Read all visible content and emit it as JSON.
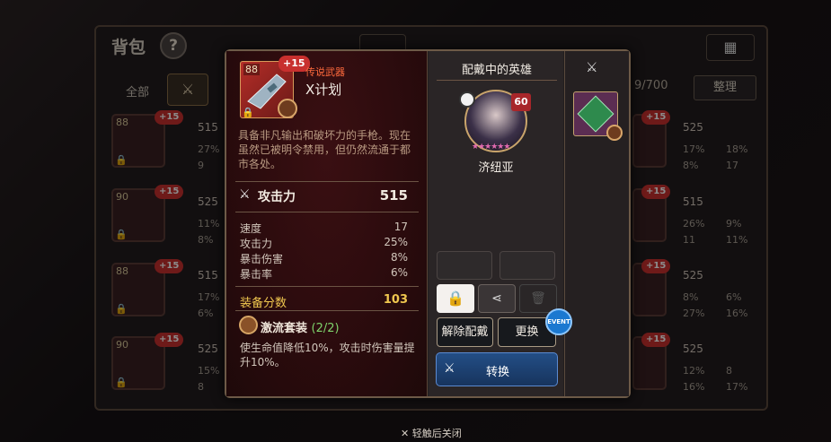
{
  "background": {
    "bag_title": "背包",
    "help_label": "?",
    "filter_all": "全部",
    "capacity": "9/700",
    "sort_label": "整理",
    "close_hint": "轻触后关闭",
    "left_items": [
      {
        "level": "88",
        "plus": "+15",
        "main": "515",
        "sub1": "27%",
        "sub2": "9"
      },
      {
        "level": "90",
        "plus": "+15",
        "main": "525",
        "sub1": "11%",
        "sub2": "8%"
      },
      {
        "level": "88",
        "plus": "+15",
        "main": "515",
        "sub1": "17%",
        "sub2": "6%"
      },
      {
        "level": "90",
        "plus": "+15",
        "main": "525",
        "sub1": "15%",
        "sub2": "8"
      }
    ],
    "right_items": [
      {
        "plus": "+15",
        "main": "525",
        "sub1": "17%",
        "sub2": "18%",
        "sub3": "8%",
        "sub4": "17"
      },
      {
        "plus": "+15",
        "main": "515",
        "sub1": "26%",
        "sub2": "9%",
        "sub3": "11",
        "sub4": "11%"
      },
      {
        "plus": "+15",
        "main": "525",
        "sub1": "8%",
        "sub2": "6%",
        "sub3": "27%",
        "sub4": "16%"
      },
      {
        "plus": "+15",
        "main": "525",
        "sub1": "12%",
        "sub2": "8",
        "sub3": "16%",
        "sub4": "17%"
      }
    ]
  },
  "item": {
    "level": "88",
    "plus": "+15",
    "rarity": "传说武器",
    "name": "X计划",
    "description": "具备非凡输出和破坏力的手枪。现在虽然已被明令禁用，但仍然流通于都市各处。",
    "main_stat": {
      "label": "攻击力",
      "value": "515"
    },
    "sub_stats": [
      {
        "label": "速度",
        "value": "17"
      },
      {
        "label": "攻击力",
        "value": "25%"
      },
      {
        "label": "暴击伤害",
        "value": "8%"
      },
      {
        "label": "暴击率",
        "value": "6%"
      }
    ],
    "score_label": "装备分数",
    "score_value": "103",
    "set_name": "激流套装",
    "set_count": "(2/2)",
    "set_desc": "使生命值降低10%，攻击时伤害量提升10%。"
  },
  "hero_panel": {
    "title": "配戴中的英雄",
    "hero_level": "60",
    "hero_name": "济纽亚",
    "unequip_label": "解除配戴",
    "replace_label": "更换",
    "event_badge": "EVENT",
    "convert_label": "转换"
  },
  "colors": {
    "rarity_red": "#ff6a3d",
    "score_gold": "#f0c74f",
    "set_green": "#7fd36b",
    "convert_blue": "#234e86"
  }
}
